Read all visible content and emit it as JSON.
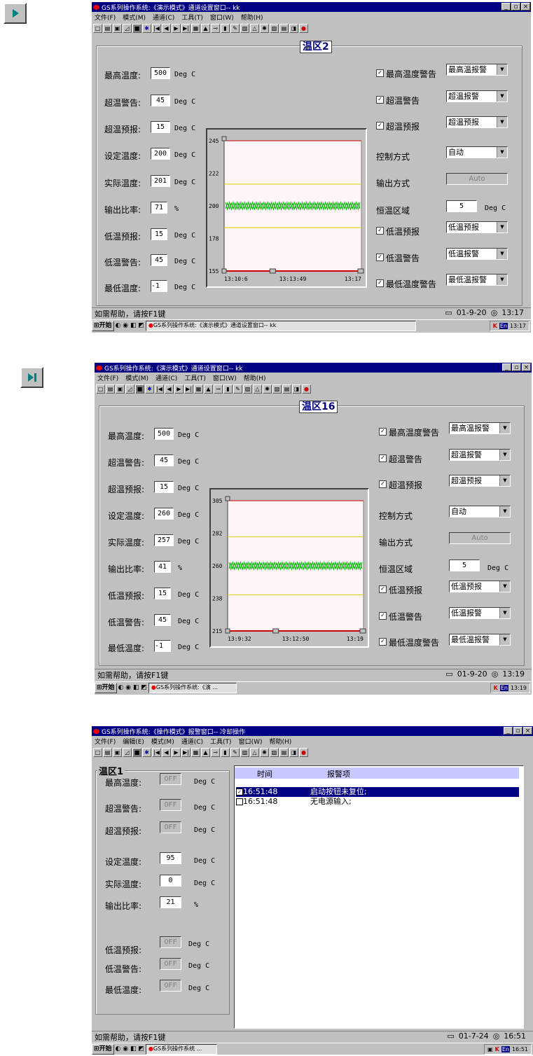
{
  "nav_buttons": {
    "play_glyph": "▶",
    "last_glyph": "▶|"
  },
  "common": {
    "menu": [
      "文件(F)",
      "模式(M)",
      "通道(C)",
      "工具(T)",
      "窗口(W)",
      "帮助(H)"
    ],
    "menu3": [
      "文件(F)",
      "编辑(E)",
      "模式(M)",
      "通道(C)",
      "工具(T)",
      "窗口(W)",
      "帮助(H)"
    ],
    "help_text": "如需帮助，请按F1键",
    "start": "开始",
    "lang": "En",
    "deg_c": "Deg C",
    "percent": "%",
    "labels": {
      "max_temp": "最高温度:",
      "overtemp_warn": "超温警告:",
      "overtemp_pre": "超温预报:",
      "set_temp": "设定温度:",
      "actual_temp": "实际温度:",
      "output_ratio": "输出比率:",
      "low_pre": "低温预报:",
      "low_warn": "低温警告:",
      "min_temp": "最低温度:"
    },
    "right_labels": {
      "max_warn": "最高温度警告",
      "over_warn": "超温警告",
      "over_pre": "超温预报",
      "ctrl_mode": "控制方式",
      "out_mode": "输出方式",
      "const_zone": "恒温区域",
      "low_pre": "低温预报",
      "low_warn": "低温警告",
      "min_warn": "最低温度警告"
    },
    "selects": {
      "max_warn": "最高温报警",
      "over_warn": "超温报警",
      "over_pre": "超温预报",
      "ctrl_mode": "自动",
      "out_mode": "Auto",
      "low_pre": "低温预报",
      "low_warn": "低温报警",
      "min_warn": "最低温报警"
    }
  },
  "window1": {
    "title": "GS系列操作系统:《演示模式》通道设置窗口-- kk",
    "zone": "温区2",
    "values": {
      "max": "500",
      "over_warn": "45",
      "over_pre": "15",
      "set": "200",
      "actual": "201",
      "ratio": "71",
      "low_pre": "15",
      "low_warn": "45",
      "min": "-1"
    },
    "const_zone_value": "5",
    "date": "01-9-20",
    "time": "13:17",
    "task_label": "GS系列操作系统:《演示模式》通道设置窗口-- kk",
    "tray_time": "13:17",
    "chart_data": {
      "type": "line",
      "yticks": [
        "245",
        "222",
        "200",
        "178",
        "155"
      ],
      "xticks": [
        "13:10:6",
        "13:13:49",
        "13:17"
      ],
      "ylim": [
        155,
        245
      ],
      "upper_limit": 215,
      "lower_limit": 185,
      "series_center": 200
    }
  },
  "window2": {
    "title": "GS系列操作系统:《演示模式》通道设置窗口-- kk",
    "zone": "温区16",
    "values": {
      "max": "500",
      "over_warn": "45",
      "over_pre": "15",
      "set": "260",
      "actual": "257",
      "ratio": "41",
      "low_pre": "15",
      "low_warn": "45",
      "min": "-1"
    },
    "const_zone_value": "5",
    "date": "01-9-20",
    "time": "13:19",
    "task_label": "GS系列操作系统:《演 ...",
    "tray_time": "13:19",
    "chart_data": {
      "type": "line",
      "yticks": [
        "305",
        "282",
        "260",
        "238",
        "215"
      ],
      "xticks": [
        "13:9:32",
        "13:12:50",
        "13:19"
      ],
      "ylim": [
        215,
        305
      ],
      "upper_limit": 280,
      "lower_limit": 240,
      "series_center": 260
    }
  },
  "window3": {
    "title": "GS系列操作系统:《操作模式》报警窗口-- 冷却操作",
    "zone": "温区1",
    "values": {
      "max": "OFF",
      "over_warn": "OFF",
      "over_pre": "OFF",
      "set": "95",
      "actual": "0",
      "ratio": "21",
      "low_pre": "OFF",
      "low_warn": "OFF",
      "min": "OFF"
    },
    "list_headers": [
      "时间",
      "报警项"
    ],
    "alarms": [
      {
        "time": "16:51:48",
        "item": "启动按钮未复位;",
        "checked": true
      },
      {
        "time": "16:51:48",
        "item": "无电源输入;",
        "checked": false
      }
    ],
    "date": "01-7-24",
    "time": "16:51",
    "task_label": "GS系列操作系统 ...",
    "tray_time": "16:51"
  }
}
